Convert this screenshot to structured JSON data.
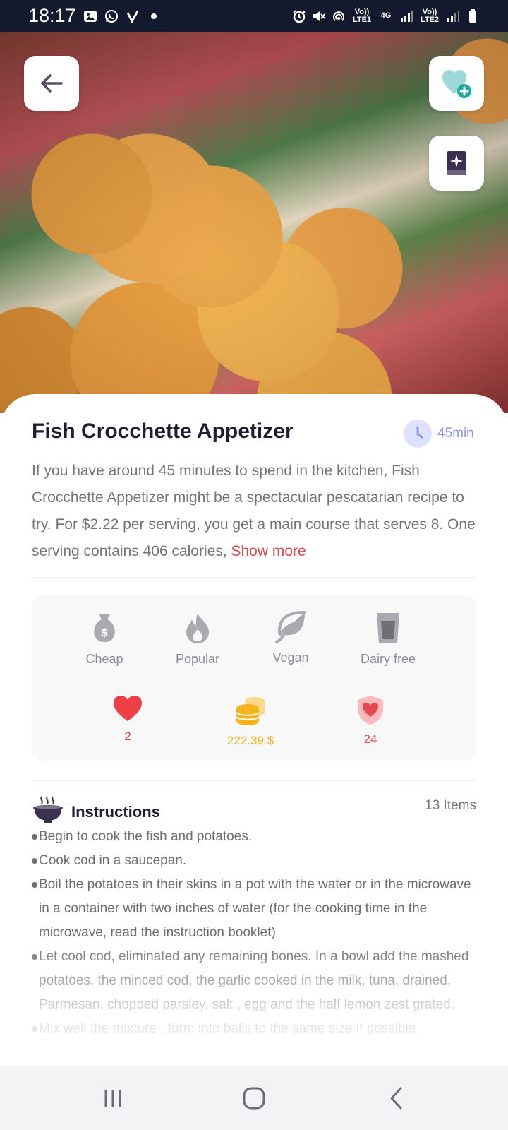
{
  "status_bar": {
    "time": "18:17",
    "left_icons": [
      "gallery-icon",
      "whatsapp-icon",
      "check-icon"
    ],
    "right_icons": [
      "alarm-icon",
      "mute-icon",
      "hotspot-icon",
      "volte1-icon",
      "4g-icon",
      "signal-icon",
      "volte2-icon",
      "signal-icon",
      "battery-icon"
    ],
    "lte1_label": "Vo)) LTE1",
    "net_label": "4G",
    "lte2_label": "Vo)) LTE2"
  },
  "header": {
    "back_icon": "arrow-left-icon",
    "favorite_icon": "heart-plus-icon",
    "magic_icon": "magic-book-icon"
  },
  "recipe": {
    "title": "Fish Crocchette Appetizer",
    "time": "45min",
    "description": "If you have around 45 minutes to spend in the kitchen, Fish Crocchette Appetizer might be a spectacular pescatarian recipe to try. For $2.22 per serving, you get a main course that serves 8. One serving contains 406 calories, ",
    "show_more": "Show more"
  },
  "attributes": [
    {
      "label": "Cheap",
      "icon": "money-bag-icon"
    },
    {
      "label": "Popular",
      "icon": "flame-icon"
    },
    {
      "label": "Vegan",
      "icon": "leaf-icon"
    },
    {
      "label": "Dairy free",
      "icon": "glass-icon"
    }
  ],
  "stats": [
    {
      "value": "2",
      "icon": "heart-icon",
      "color": "#ef3e45"
    },
    {
      "value": "222.39 $",
      "icon": "coins-icon",
      "color": "#f5b31c"
    },
    {
      "value": "24",
      "icon": "health-shield-icon",
      "color": "#e24a50"
    }
  ],
  "instructions": {
    "title": "Instructions",
    "count": "13 Items",
    "steps": [
      "Begin to cook the fish and potatoes.",
      "Cook cod in a saucepan.",
      "Boil the potatoes in their skins in a pot with the water or in the microwave in a container with two inches of water (for the cooking time in the microwave, read the instruction booklet)",
      "Let cool cod, eliminated any remaining bones. In a bowl add the mashed potatoes, the minced cod, the garlic cooked in the milk, tuna, drained, Parmesan, chopped parsley, salt , egg and the half lemon zest grated.",
      "Mix well the mixture , form into balls to the same size if possible"
    ]
  },
  "nav": {
    "recents_icon": "recents-icon",
    "home_icon": "home-icon",
    "back_icon": "back-icon"
  },
  "colors": {
    "accent_red": "#e0474c",
    "time_blue": "#8f98e8",
    "title_dark": "#1f1d33"
  }
}
